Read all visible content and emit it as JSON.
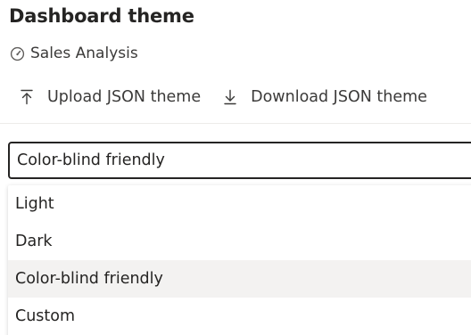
{
  "header": {
    "title": "Dashboard theme",
    "report_name": "Sales Analysis",
    "report_icon": "gauge-icon"
  },
  "toolbar": {
    "upload_label": "Upload JSON theme",
    "upload_icon": "upload-icon",
    "download_label": "Download JSON theme",
    "download_icon": "download-icon"
  },
  "theme_dropdown": {
    "selected": "Color-blind friendly",
    "options": [
      "Light",
      "Dark",
      "Color-blind friendly",
      "Custom"
    ],
    "highlighted_index": 2
  },
  "colors": {
    "text": "#252423",
    "border": "#252423",
    "highlight": "#f3f2f1"
  }
}
